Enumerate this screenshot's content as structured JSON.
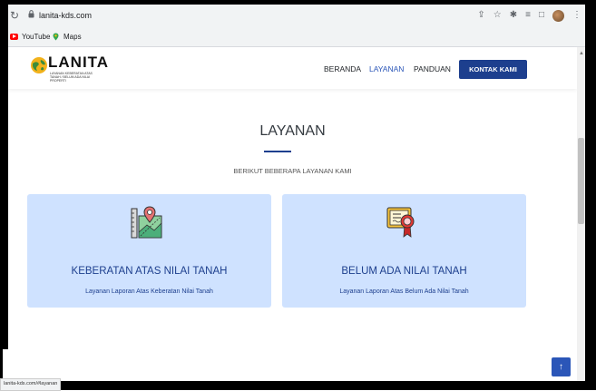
{
  "browser": {
    "url": "lanita-kds.com",
    "bookmarks": [
      {
        "label": "YouTube"
      },
      {
        "label": "Maps"
      }
    ],
    "status_url": "lanita-kds.com/#layanan"
  },
  "header": {
    "logo_name": "LANITA",
    "logo_tagline": "LAYANAN KEBERATAN ATAS TANAH / BELUM ADA NILAI PROPERTI",
    "nav": [
      {
        "label": "BERANDA"
      },
      {
        "label": "LAYANAN"
      },
      {
        "label": "PANDUAN"
      }
    ],
    "cta_label": "KONTAK KAMI"
  },
  "section": {
    "title": "LAYANAN",
    "subtitle": "BERIKUT BEBERAPA LAYANAN KAMI"
  },
  "cards": [
    {
      "title": "KEBERATAN ATAS NILAI TANAH",
      "desc": "Layanan Laporan Atas Keberatan Nilai Tanah",
      "icon": "land-map-icon"
    },
    {
      "title": "BELUM ADA NILAI TANAH",
      "desc": "Layanan Laporan Atas Belum Ada Nilai Tanah",
      "icon": "certificate-icon"
    }
  ],
  "colors": {
    "primary": "#1d3f8e",
    "nav_active": "#2b56b8",
    "card_bg": "#cfe2ff"
  }
}
